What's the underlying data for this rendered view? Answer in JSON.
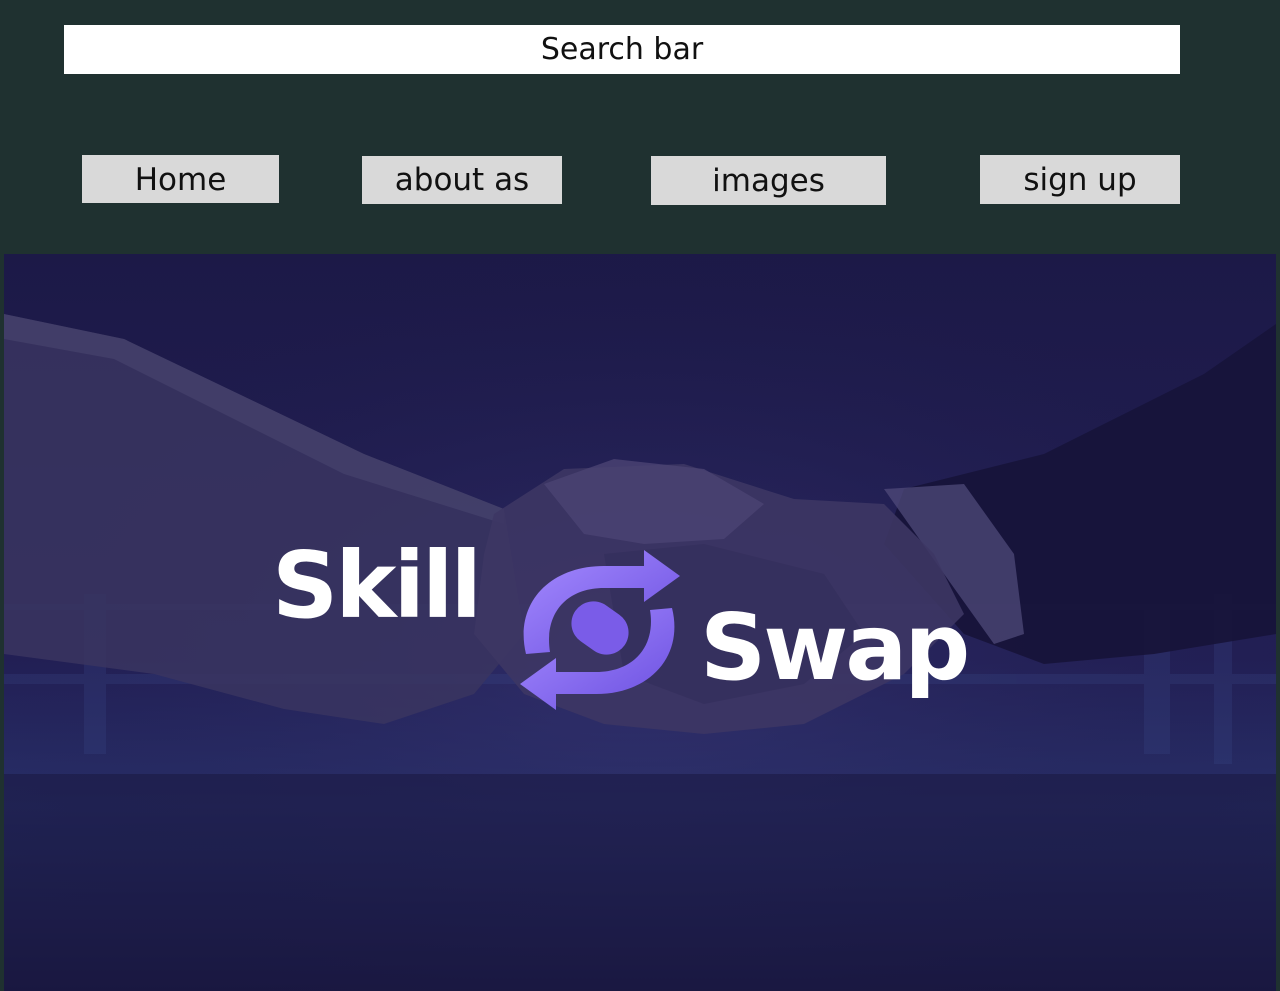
{
  "search": {
    "placeholder": "Search bar"
  },
  "nav": {
    "home_label": "Home",
    "about_label": "about as",
    "images_label": "images",
    "signup_label": "sign up"
  },
  "hero": {
    "logo_text_1": "Skill",
    "logo_text_2": "Swap",
    "logo_icon": "swap-arrows-icon",
    "background_image": "handshake-photo"
  },
  "colors": {
    "page_bg": "#1f3130",
    "button_bg": "#d9d9d9",
    "search_bg": "#ffffff",
    "hero_overlay": "#1b1845",
    "logo_accent": "#7b5cf0"
  }
}
